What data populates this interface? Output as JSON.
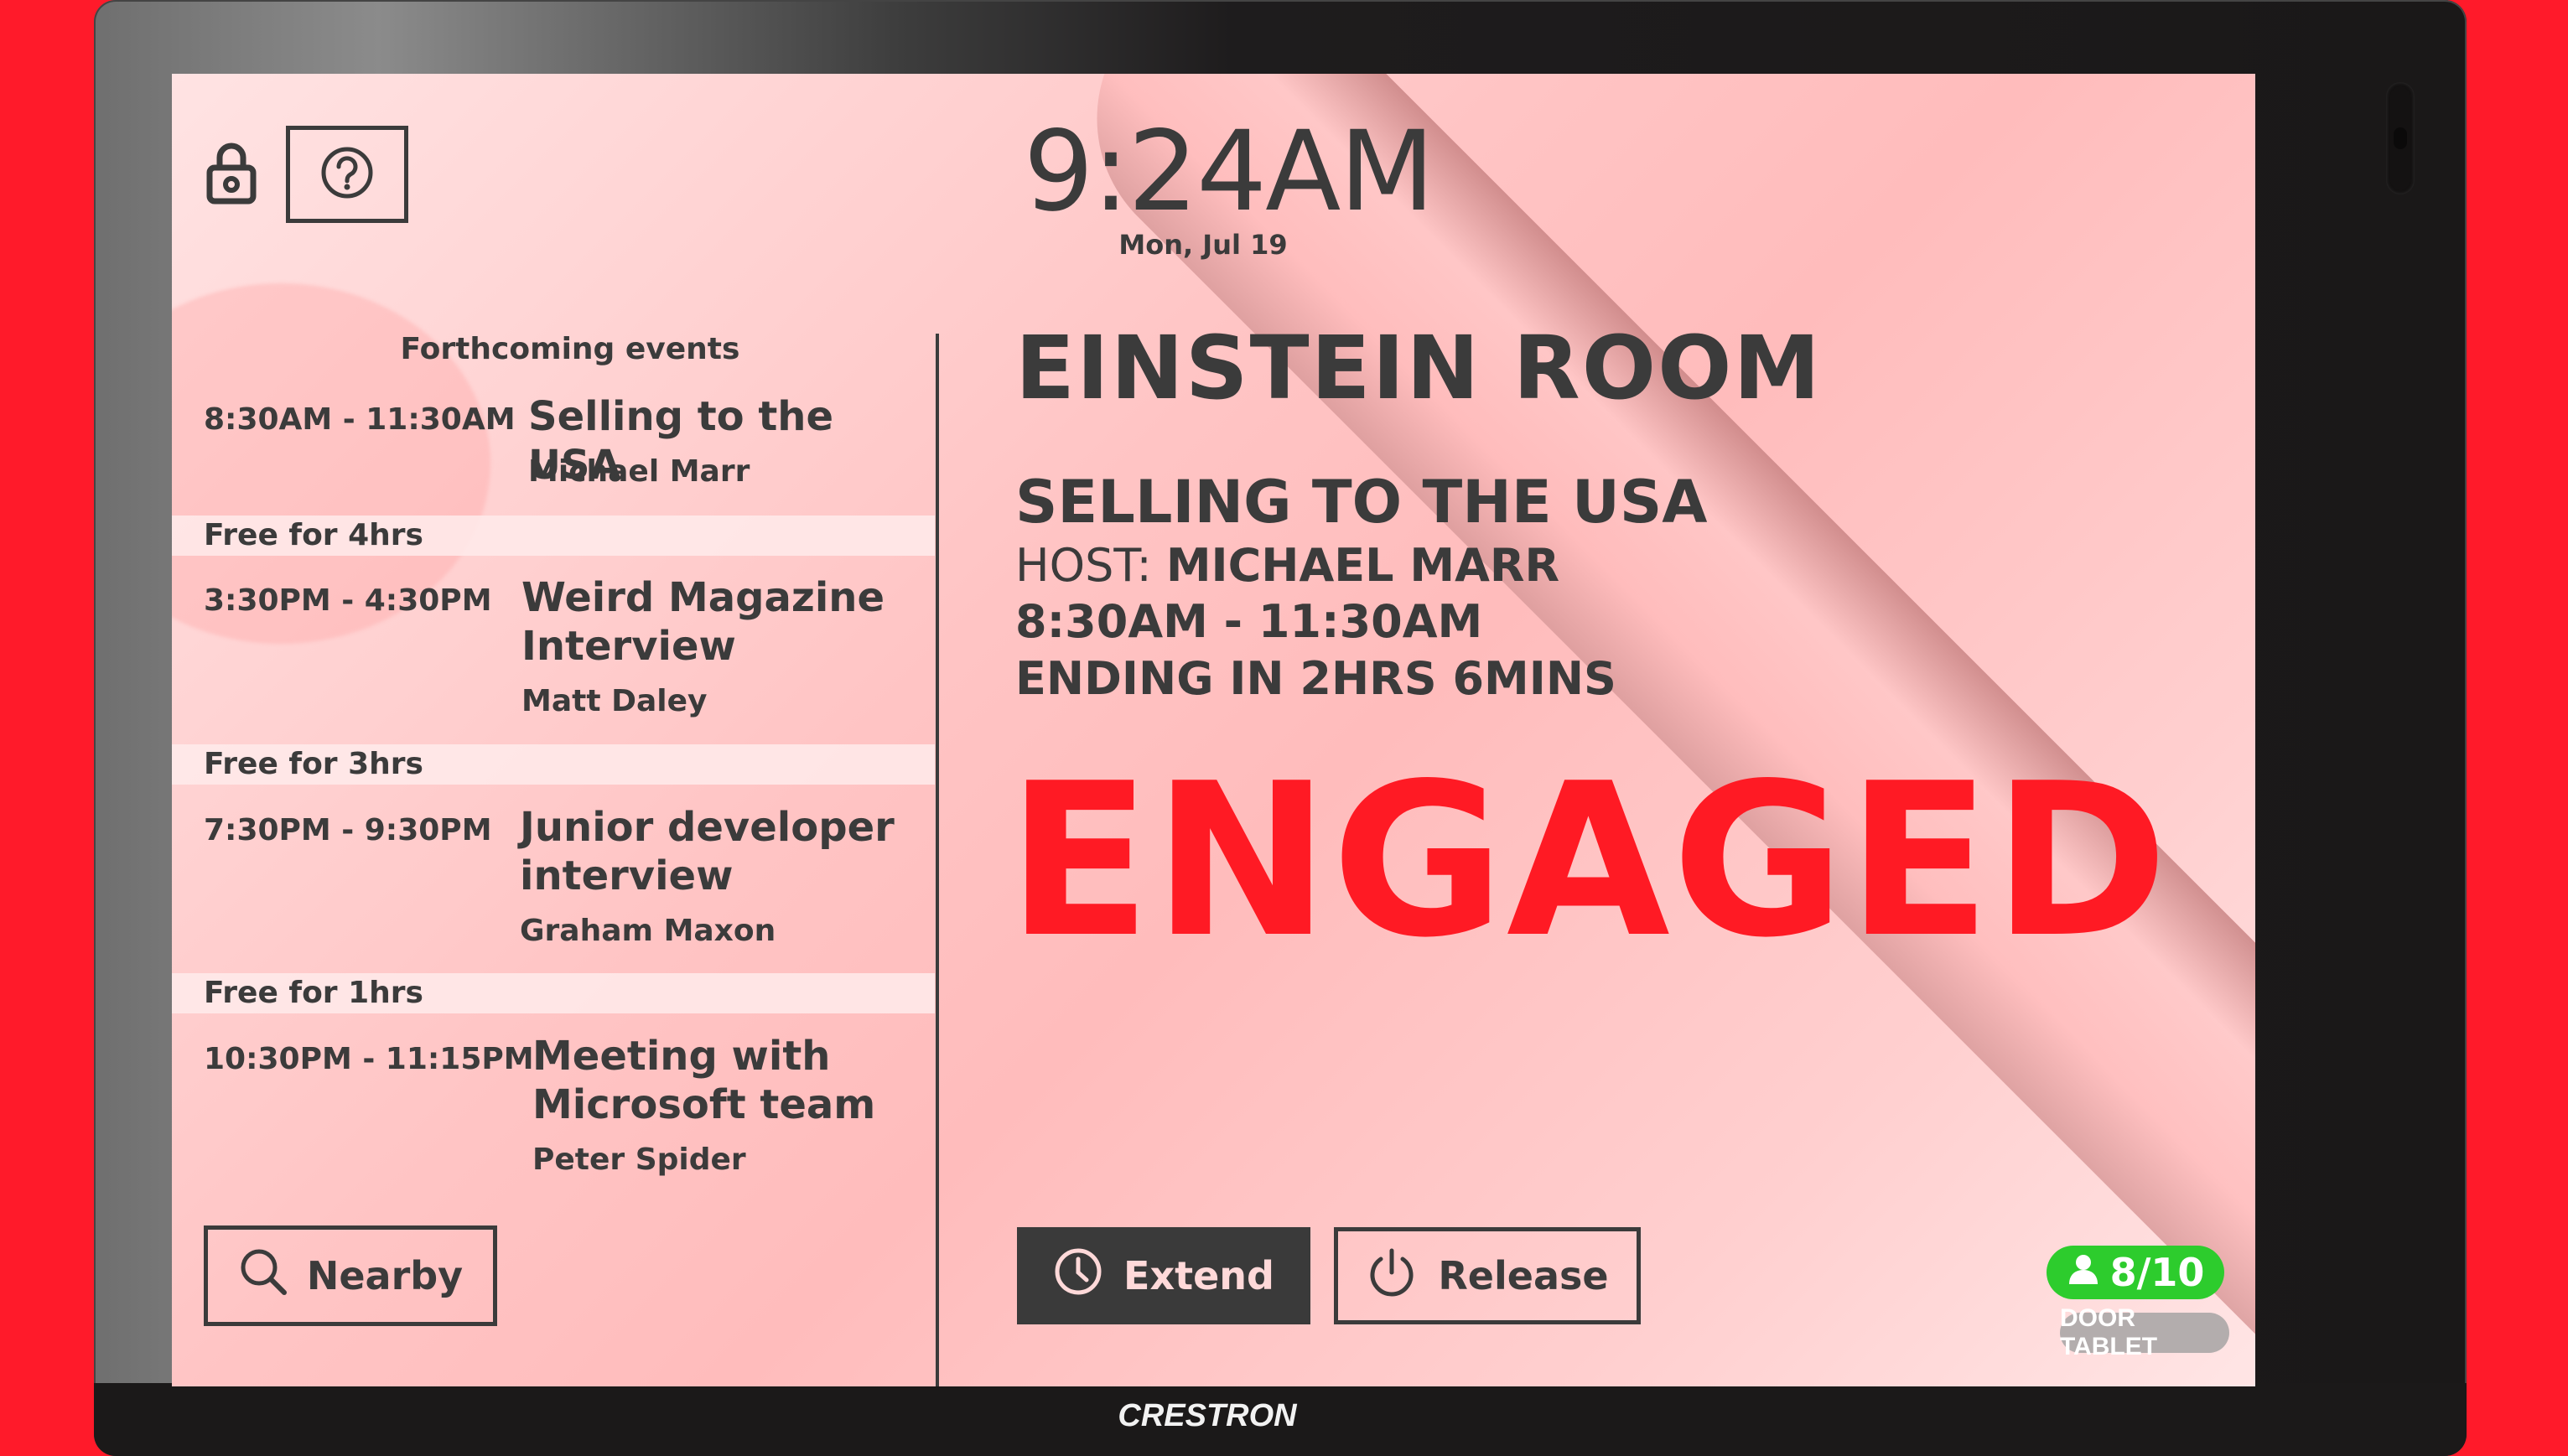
{
  "device": {
    "brand": "CRESTRON"
  },
  "header": {
    "time": "9:24AM",
    "date": "Mon, Jul 19",
    "lock_icon": "lock-icon",
    "help_icon": "question-circle-icon"
  },
  "events": {
    "title": "Forthcoming events",
    "items": [
      {
        "time": "8:30AM - 11:30AM",
        "title": "Selling to the USA",
        "host": "Michael Marr"
      },
      {
        "time": "3:30PM - 4:30PM",
        "title": "Weird Magazine Interview",
        "host": "Matt Daley"
      },
      {
        "time": "7:30PM - 9:30PM",
        "title": "Junior developer interview",
        "host": "Graham Maxon"
      },
      {
        "time": "10:30PM - 11:15PM",
        "title": "Meeting with Microsoft team",
        "host": "Peter Spider"
      }
    ],
    "free_slots": [
      "Free for 4hrs",
      "Free for 3hrs",
      "Free for 1hrs"
    ]
  },
  "nearby": {
    "label": "Nearby",
    "icon": "search-icon"
  },
  "room": {
    "name": "EINSTEIN ROOM",
    "meeting_title": "SELLING TO THE USA",
    "host_label": "HOST:",
    "host_name": "MICHAEL MARR",
    "time_range": "8:30AM - 11:30AM",
    "ending": "ENDING IN 2HRS 6MINS",
    "status": "ENGAGED",
    "status_color": "#ff1a24"
  },
  "actions": {
    "extend_label": "Extend",
    "extend_icon": "clock-icon",
    "release_label": "Release",
    "release_icon": "power-icon"
  },
  "capacity": {
    "value": "8/10",
    "icon": "person-icon",
    "color": "#2dcc2d"
  },
  "device_label": "DOOR TABLET"
}
